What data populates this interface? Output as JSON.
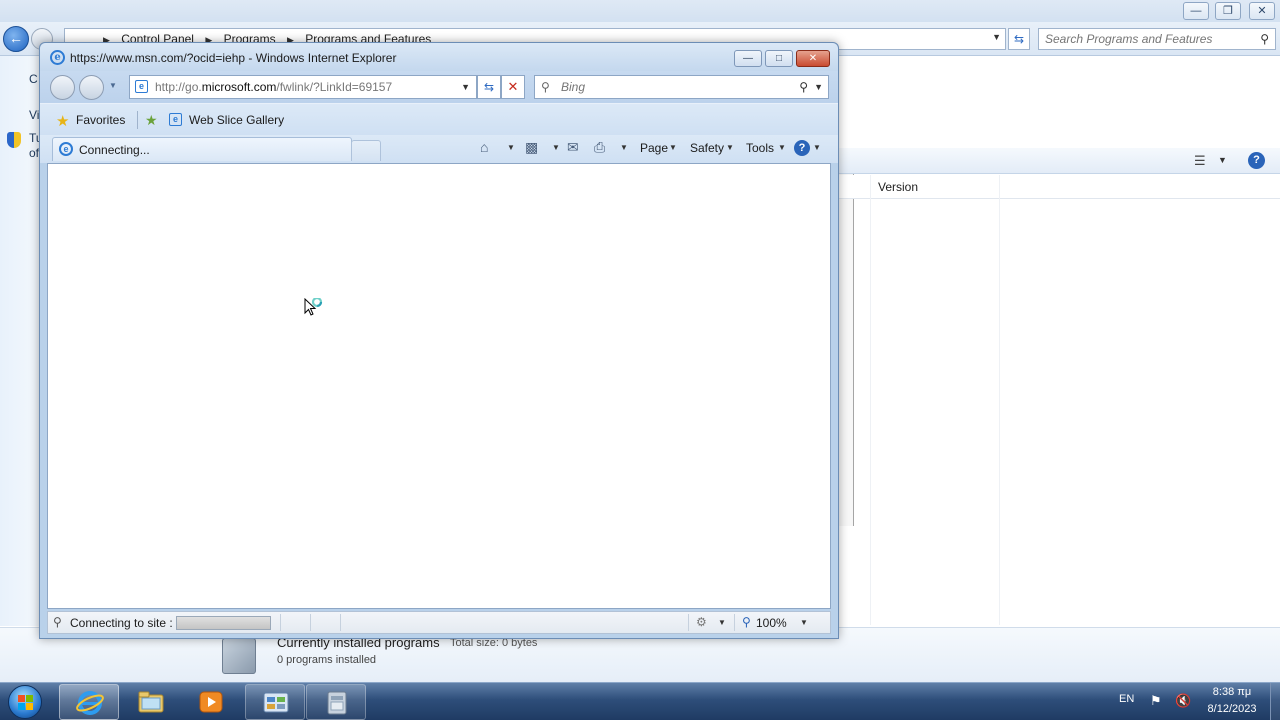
{
  "control_panel": {
    "breadcrumb": [
      "Control Panel",
      "Programs",
      "Programs and Features"
    ],
    "search_placeholder": "Search Programs and Features",
    "left_pane_fragments": [
      "C",
      "Vi",
      "Tu",
      "of"
    ],
    "column_version": "Version",
    "details": {
      "title": "Currently installed programs",
      "total_size": "Total size: 0 bytes",
      "count": "0 programs installed"
    }
  },
  "ie": {
    "window_title": "https://www.msn.com/?ocid=iehp - Windows Internet Explorer",
    "url_prefix": "http://go.",
    "url_domain": "microsoft.com",
    "url_suffix": "/fwlink/?LinkId=69157",
    "search_placeholder": "Bing",
    "favorites_label": "Favorites",
    "web_slice_gallery": "Web Slice Gallery",
    "tab_label": "Connecting...",
    "commands": {
      "page": "Page",
      "safety": "Safety",
      "tools": "Tools"
    },
    "status_text": "Connecting to site :",
    "progress": 1.0,
    "zoom": "100%"
  },
  "taskbar": {
    "items": [
      "start-button",
      "internet-explorer",
      "windows-explorer",
      "media-player",
      "control-panel",
      "programs-features"
    ],
    "language": "EN",
    "time": "8:38 πμ",
    "date": "8/12/2023"
  },
  "colors": {
    "ie_frame": "#b9d1ea",
    "ie_close": "#c94b30",
    "taskbar": "#2e4e7a",
    "accent_blue": "#2d7bd4"
  }
}
